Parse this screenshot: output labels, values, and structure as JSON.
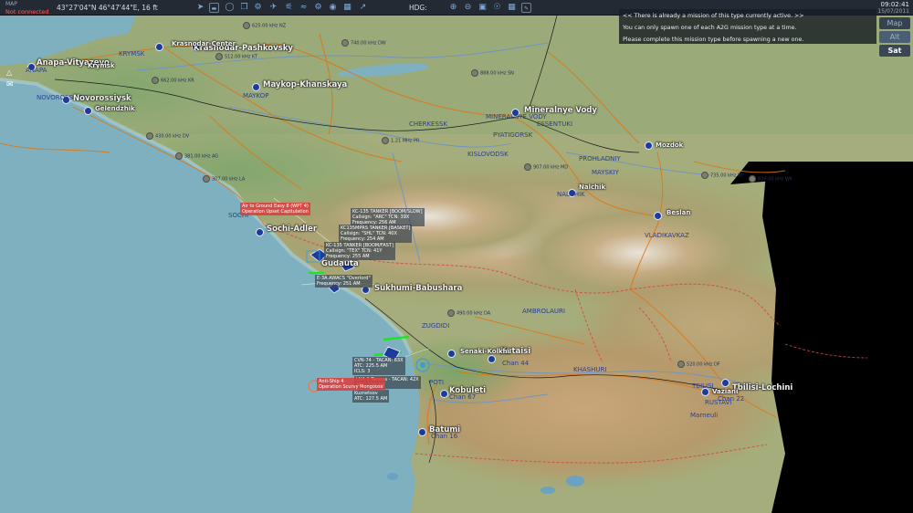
{
  "topbar": {
    "brand": "MAP",
    "connection_status": "Not connected",
    "coordinates": "43°27'04\"N 46°47'44\"E, 16 ft",
    "heading_label": "HDG:",
    "clock": "09:02:41",
    "date": "15/07/2011"
  },
  "notification": {
    "line1": "<< There is already a mission of this type currently active. >>",
    "line2": "You can only spawn one of each A2G mission type at a time.",
    "line3": "Please complete this mission type before spawning a new one."
  },
  "map_type_buttons": [
    "Map",
    "Alt",
    "Sat"
  ],
  "cities": [
    {
      "name": "Anapa-Vityazevo"
    },
    {
      "name": "Novorossiysk"
    },
    {
      "name": "Gelendzhik"
    },
    {
      "name": "Krymsk"
    },
    {
      "name": "Krasnodar-Pashkovsky"
    },
    {
      "name": "Krasnodar-Center"
    },
    {
      "name": "Maykop-Khanskaya"
    },
    {
      "name": "Mineralnye Vody"
    },
    {
      "name": "Nalchik"
    },
    {
      "name": "Mozdok"
    },
    {
      "name": "Beslan"
    },
    {
      "name": "Sochi-Adler"
    },
    {
      "name": "Gudauta"
    },
    {
      "name": "Sukhumi-Babushara"
    },
    {
      "name": "Kutaisi"
    },
    {
      "name": "Senaki-Kolkhi"
    },
    {
      "name": "Kobuleti"
    },
    {
      "name": "Batumi"
    },
    {
      "name": "Tbilisi-Lochini"
    },
    {
      "name": "Vaziani"
    }
  ],
  "regions": [
    "CHERKESSK",
    "MINERALNYE VODY",
    "PYATIGORSK",
    "KISLOVODSK",
    "PROHLADNIY",
    "MAYSKIY",
    "NALCHIK",
    "VLADIKAVKAZ",
    "ZUGDIDI",
    "AMBROLAURI",
    "KHASHURI",
    "RUSTAVI",
    "Marneuli",
    "ANAPA",
    "KRYMSK",
    "NOVOROSSIYSK",
    "SOCHI",
    "MAYKOP",
    "ESSENTUKI",
    "POTI",
    "TBILISI",
    "Chan 22",
    "Chan 44",
    "Chan 67",
    "Chan 16"
  ],
  "beacons": [
    "740.00 kHz DW",
    "662.00 kHz KR",
    "430.00 kHz DV",
    "381.00 kHz AG",
    "307.00 kHz LA",
    "888.00 kHz SN",
    "1.21 MHz PR",
    "907.00 kHz MD",
    "735.00 kHz BJ",
    "830.00 kHz WK",
    "520.00 kHz DF",
    "490.00 kHz DA",
    "512.00 kHz KT",
    "625.00 kHz NZ"
  ],
  "unit_cards": [
    {
      "l1": "Air to Ground Easy 8 (WPT 4)",
      "l2": "Operation Upset Capitulation"
    },
    {
      "l1": "KC-135 TANKER [BOOM/SLOW]",
      "l2": "Callsign: \"ARC\" TCN: 39X",
      "l3": "Frequency: 256 AM"
    },
    {
      "l1": "KC135MPRS TANKER [BASKET]",
      "l2": "Callsign: \"SHL\" TCN: 40X",
      "l3": "Frequency: 254 AM"
    },
    {
      "l1": "KC-135 TANKER [BOOM/FAST]",
      "l2": "Callsign: \"TEX\" TCN: 41Y",
      "l3": "Frequency: 255 AM"
    },
    {
      "l1": "E-3A AWACS \"Overlord\"",
      "l2": "Frequency: 251 AM"
    },
    {
      "l1": "CVN-74 - TACAN: 63X",
      "l2": "ATC: 225.5 AM",
      "l3": "ICLS: 3"
    },
    {
      "l1": "LHA-1 Tarawa - TACAN: 42X",
      "l2": "ATC: 124 AM"
    },
    {
      "l1": "Kuznetsov",
      "l2": "ATC: 127.5 AM"
    },
    {
      "l1": "Anti-Ship 4",
      "l2": "Operation Scurvy Mongoose"
    }
  ],
  "colors": {
    "sea": "#7fb0bf",
    "coast_green": "#7faa6e",
    "mountain": "#c9b490",
    "snow": "#e8e4dc",
    "road": "#e0740e",
    "river": "#6e94c4",
    "border": "#d2463c",
    "topbar": "#232a33",
    "friendly_marker": "#1c3c9a"
  }
}
